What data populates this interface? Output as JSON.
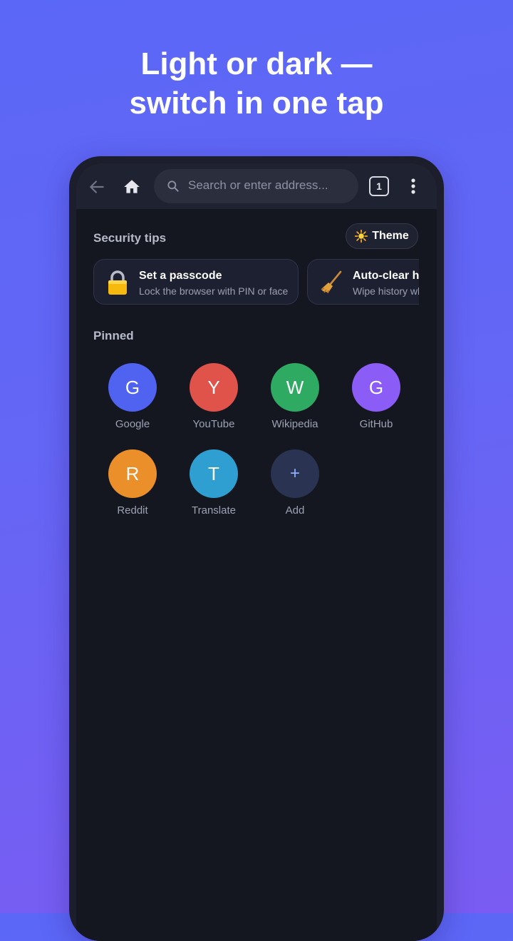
{
  "headline": {
    "line1": "Light or dark —",
    "line2": "switch in one tap"
  },
  "toolbar": {
    "back_icon": "arrow-left-icon",
    "home_icon": "home-icon",
    "search_placeholder": "Search or enter address...",
    "tab_count": "1",
    "menu_icon": "more-vertical-icon"
  },
  "security": {
    "title": "Security tips",
    "theme_button": {
      "icon": "sun-icon",
      "label": "Theme"
    },
    "tips": [
      {
        "icon": "lock-icon",
        "title": "Set a passcode",
        "subtitle": "Lock the browser with PIN or face"
      },
      {
        "icon": "broom-icon",
        "title": "Auto-clear history",
        "subtitle": "Wipe history when you exit"
      }
    ]
  },
  "pinned": {
    "title": "Pinned",
    "items": [
      {
        "letter": "G",
        "label": "Google",
        "color": "#4f63f0"
      },
      {
        "letter": "Y",
        "label": "YouTube",
        "color": "#e0534a"
      },
      {
        "letter": "W",
        "label": "Wikipedia",
        "color": "#2faa63"
      },
      {
        "letter": "G",
        "label": "GitHub",
        "color": "#8b5cf6"
      },
      {
        "letter": "R",
        "label": "Reddit",
        "color": "#ea8f2a"
      },
      {
        "letter": "T",
        "label": "Translate",
        "color": "#2f9fd1"
      },
      {
        "letter": "+",
        "label": "Add",
        "color": "#2b3352"
      }
    ]
  }
}
